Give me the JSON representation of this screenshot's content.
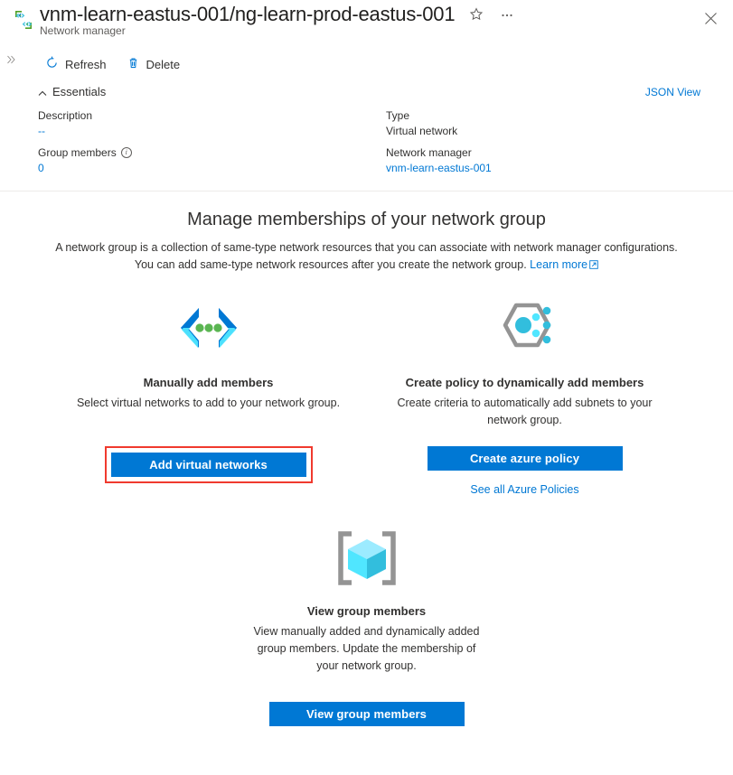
{
  "header": {
    "title": "vnm-learn-eastus-001/ng-learn-prod-eastus-001",
    "subtitle": "Network manager",
    "resource_icon": "network-manager-icon",
    "favorite_icon": "star-outline-icon",
    "more_icon": "ellipsis-icon",
    "close_icon": "close-icon"
  },
  "nav": {
    "expand_icon": "double-chevron-right-icon"
  },
  "commands": [
    {
      "label": "Refresh",
      "icon": "refresh-icon"
    },
    {
      "label": "Delete",
      "icon": "trash-icon"
    }
  ],
  "essentials": {
    "toggle_label": "Essentials",
    "toggle_icon": "chevron-up-icon",
    "json_view_label": "JSON View",
    "fields": [
      {
        "label": "Description",
        "value": "--",
        "is_link": false,
        "muted": true
      },
      {
        "label": "Type",
        "value": "Virtual network",
        "is_link": false,
        "muted": false
      },
      {
        "label": "Group members",
        "value": "0",
        "is_link": false,
        "muted": true,
        "info_icon": "info-icon"
      },
      {
        "label": "Network manager",
        "value": "vnm-learn-eastus-001",
        "is_link": true,
        "muted": false
      }
    ]
  },
  "hero": {
    "title": "Manage memberships of your network group",
    "description": "A network group is a collection of same-type network resources that you can associate with network manager configurations. You can add same-type network resources after you create the network group.",
    "learn_more_label": "Learn more",
    "learn_more_icon": "external-link-icon"
  },
  "cards": {
    "manual": {
      "icon": "code-brackets-dots-icon",
      "title": "Manually add members",
      "description": "Select virtual networks to add to your network group.",
      "button_label": "Add virtual networks",
      "highlighted": true
    },
    "policy": {
      "icon": "hexagon-nodes-icon",
      "title": "Create policy to dynamically add members",
      "description": "Create criteria to automatically add subnets to your network group.",
      "button_label": "Create azure policy",
      "sub_link_label": "See all Azure Policies"
    },
    "view": {
      "icon": "cube-brackets-icon",
      "title": "View group members",
      "description": "View manually added and dynamically added group members. Update the membership of your network group.",
      "button_label": "View group members"
    }
  },
  "colors": {
    "accent": "#0078d4",
    "link": "#0078d4",
    "highlight_border": "#f03a2e",
    "icon_green": "#5ab552",
    "icon_cyan": "#32bedd",
    "icon_grey": "#949494"
  }
}
